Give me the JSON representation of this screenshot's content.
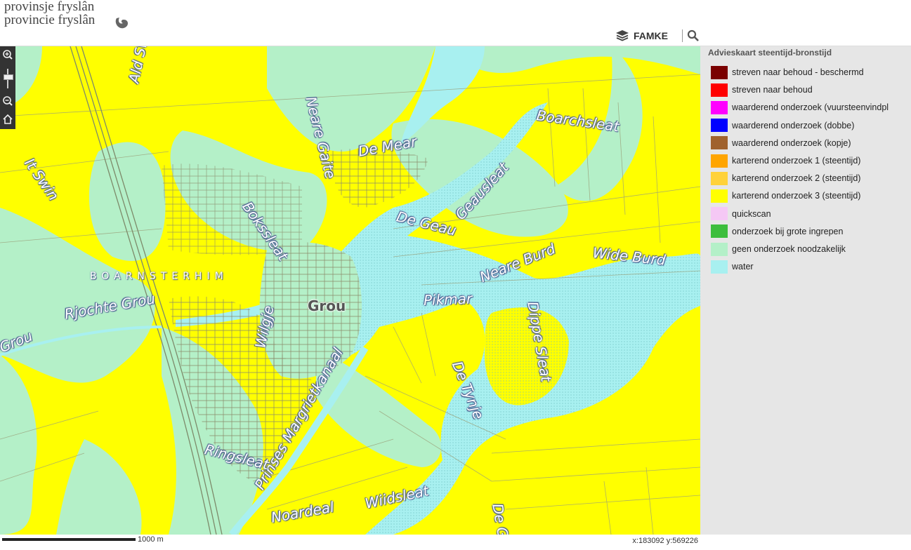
{
  "header": {
    "logo_line1": "provinsje fryslân",
    "logo_line2": "provincie fryslân",
    "famke_label": "FAMKE"
  },
  "icons": {
    "zoom_in": "zoom-in-icon",
    "zoom_out": "zoom-out-icon",
    "home": "home-icon",
    "layers": "layers-icon",
    "search": "search-icon"
  },
  "map": {
    "labels": {
      "ald_swin": "Ald Swin",
      "neare_gaite": "Neare Gaite",
      "boarchsleat": "Boarchsleat",
      "de_mear": "De Mear",
      "it_swin": "It Swin",
      "bokssleat": "Bokssleat",
      "de_geau": "De Geau",
      "geausleat": "Geausleat",
      "wide_burd": "Wide Burd",
      "neare_burd": "Neare Burd",
      "boarnsterhim": "BOARNSTERHIM",
      "rjochte_grou": "Rjochte Grou",
      "grou_town": "Grou",
      "pikmar": "Pikmar",
      "grou_left": "Grou",
      "dippe_sleat": "Dippe Sleat",
      "de_tynje": "De Tynje",
      "wilgje": "Wilgje",
      "prinses_margrietkanaal": "Prinses Margrietkanaal",
      "ringsleat": "Ringsleat",
      "wiidsleat": "Wiidsleat",
      "noardeal": "Noardeal",
      "de_gl": "De Gl"
    },
    "colors": {
      "yellow": "#ffff00",
      "light_green": "#b4f0c8",
      "water": "#a8f0f0"
    }
  },
  "legend": {
    "title": "Advieskaart steentijd-bronstijd",
    "items": [
      {
        "label": "streven naar behoud - beschermd",
        "color": "#7a0000"
      },
      {
        "label": "streven naar behoud",
        "color": "#ff0000"
      },
      {
        "label": "waarderend onderzoek (vuursteenvindpl",
        "color": "#ff00ff"
      },
      {
        "label": "waarderend onderzoek (dobbe)",
        "color": "#0000ff"
      },
      {
        "label": "waarderend onderzoek (kopje)",
        "color": "#a0622d"
      },
      {
        "label": "karterend onderzoek 1 (steentijd)",
        "color": "#ffa500"
      },
      {
        "label": "karterend onderzoek 2 (steentijd)",
        "color": "#ffd23a"
      },
      {
        "label": "karterend onderzoek 3 (steentijd)",
        "color": "#ffff00"
      },
      {
        "label": "quickscan",
        "color": "#f5c8f5"
      },
      {
        "label": "onderzoek bij grote ingrepen",
        "color": "#3cbe3c"
      },
      {
        "label": "geen onderzoek noodzakelijk",
        "color": "#b4f0c8"
      },
      {
        "label": "water",
        "color": "#a8f0f0"
      }
    ]
  },
  "footer": {
    "scale_label": "1000 m",
    "coords": "x:183092  y:569226"
  }
}
